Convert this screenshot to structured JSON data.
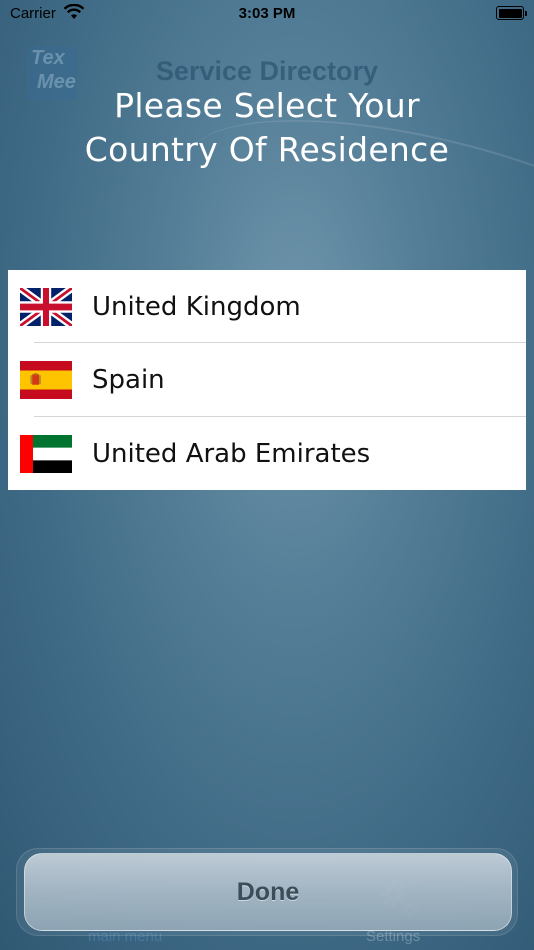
{
  "status_bar": {
    "carrier": "Carrier",
    "time": "3:03 PM"
  },
  "background": {
    "logo_lines": [
      "Tex",
      "Mee"
    ],
    "app_title": "Service Directory"
  },
  "dialog": {
    "title_line1": "Please Select Your",
    "title_line2": "Country Of Residence"
  },
  "countries": [
    {
      "name": "United Kingdom",
      "flag": "uk-flag-icon"
    },
    {
      "name": "Spain",
      "flag": "spain-flag-icon"
    },
    {
      "name": "United Arab Emirates",
      "flag": "uae-flag-icon"
    }
  ],
  "tab_bar": {
    "main_menu_label": "main menu",
    "settings_label": "Settings"
  },
  "done_button": "Done",
  "colors": {
    "background": "#4a7590",
    "list_background": "#ffffff",
    "done_text": "#3b4a56"
  }
}
